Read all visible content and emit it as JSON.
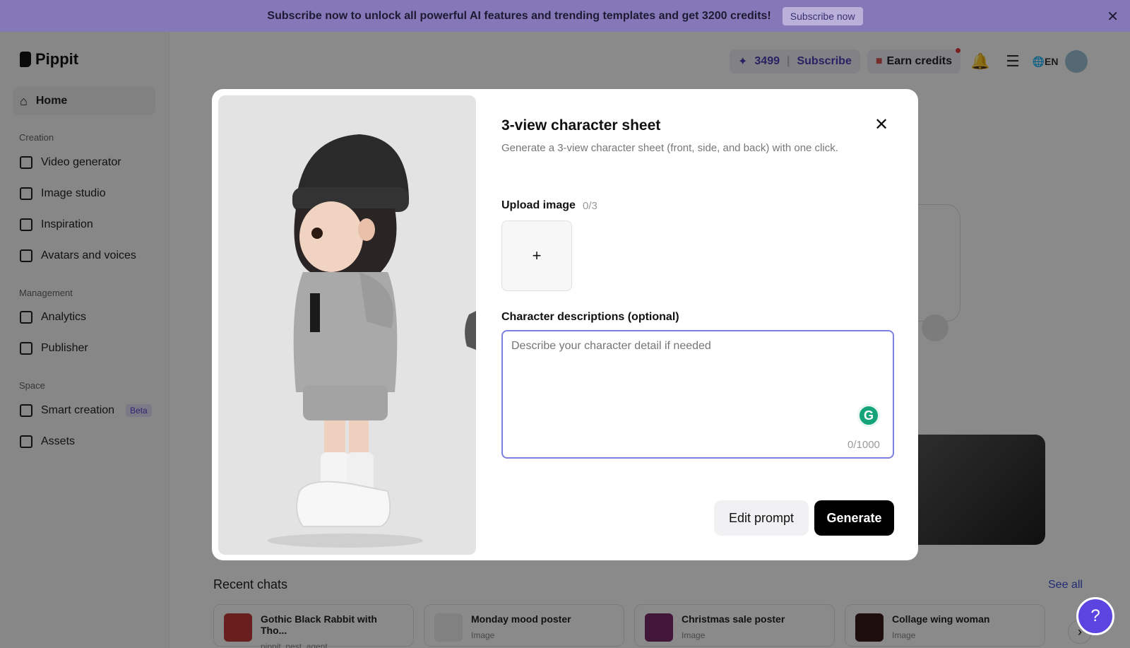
{
  "banner": {
    "text": "Subscribe now to unlock all powerful AI features and trending templates and get 3200 credits!",
    "button": "Subscribe now"
  },
  "brand": {
    "name": "Pippit"
  },
  "sidebar": {
    "home": "Home",
    "sections": [
      {
        "title": "Creation",
        "items": [
          "Video generator",
          "Image studio",
          "Inspiration",
          "Avatars and voices"
        ]
      },
      {
        "title": "Management",
        "items": [
          "Analytics",
          "Publisher"
        ]
      },
      {
        "title": "Space",
        "items": [
          "Smart creation",
          "Assets"
        ]
      }
    ],
    "beta_badge": "Beta"
  },
  "topbar": {
    "credits": "3499",
    "subscribe": "Subscribe",
    "earn_credits": "Earn credits",
    "language": "EN"
  },
  "recent": {
    "title": "Recent chats",
    "see_all": "See all",
    "chats": [
      {
        "title": "Gothic Black Rabbit with Tho...",
        "subtitle": "pippit_nest_agent"
      },
      {
        "title": "Monday mood poster",
        "subtitle": "Image"
      },
      {
        "title": "Christmas sale poster",
        "subtitle": "Image"
      },
      {
        "title": "Collage wing woman",
        "subtitle": "Image"
      }
    ]
  },
  "modal": {
    "title": "3-view character sheet",
    "description": "Generate a 3-view character sheet (front, side, and back) with one click.",
    "upload_label": "Upload image",
    "upload_count": "0/3",
    "upload_plus": "+",
    "desc_label": "Character descriptions (optional)",
    "desc_placeholder": "Describe your character detail if needed",
    "char_count": "0/1000",
    "edit_prompt": "Edit prompt",
    "generate": "Generate"
  },
  "colors": {
    "banner_bg": "#8578b8",
    "accent": "#5b45e0",
    "generate_bg": "#000000"
  }
}
